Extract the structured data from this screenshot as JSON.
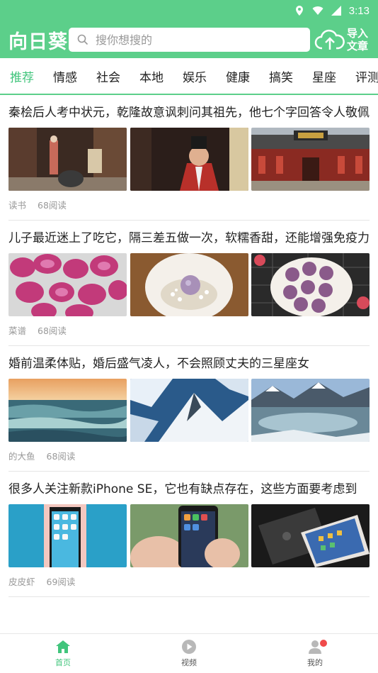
{
  "status": {
    "time": "3:13"
  },
  "header": {
    "brand": "向日葵",
    "search_placeholder": "搜你想搜的",
    "import_label": "导入文章"
  },
  "tabs": [
    "推荐",
    "情感",
    "社会",
    "本地",
    "娱乐",
    "健康",
    "搞笑",
    "星座",
    "评测"
  ],
  "articles": [
    {
      "title": "秦桧后人考中状元，乾隆故意讽刺问其祖先，他七个字回答令人敬佩",
      "source": "读书",
      "reads": "68阅读"
    },
    {
      "title": "儿子最近迷上了吃它，隔三差五做一次，软糯香甜，还能增强免疫力",
      "source": "菜谱",
      "reads": "68阅读"
    },
    {
      "title": "婚前温柔体贴，婚后盛气凌人，不会照顾丈夫的三星座女",
      "source": "的大鱼",
      "reads": "68阅读"
    },
    {
      "title": "很多人关注新款iPhone SE，它也有缺点存在，这些方面要考虑到",
      "source": "皮皮虾",
      "reads": "69阅读"
    }
  ],
  "bottom_nav": [
    {
      "label": "首页",
      "icon": "home-icon"
    },
    {
      "label": "视频",
      "icon": "video-icon"
    },
    {
      "label": "我的",
      "icon": "user-icon"
    }
  ],
  "colors": {
    "brand_green": "#5ccf8a",
    "active_green": "#41c57c",
    "badge_red": "#f04a4a"
  }
}
